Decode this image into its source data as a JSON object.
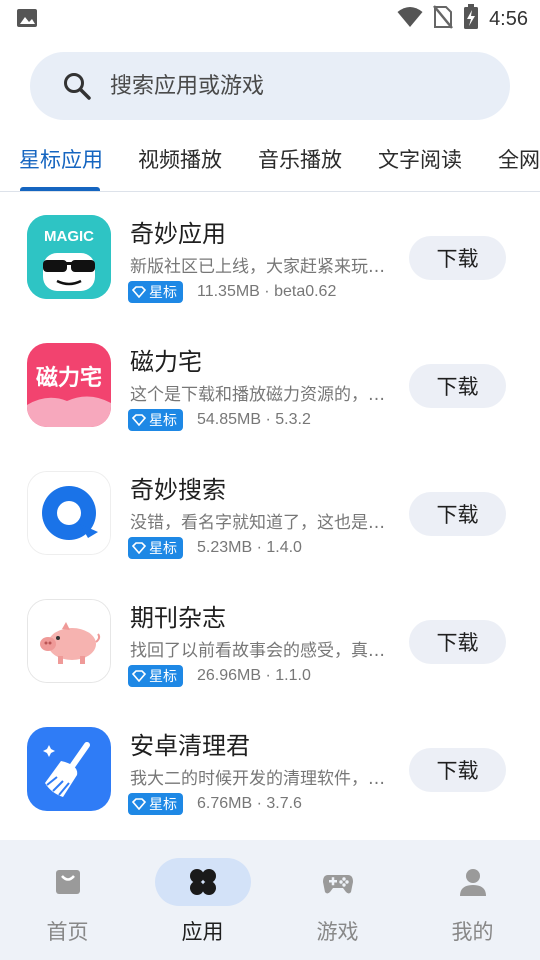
{
  "status": {
    "time": "4:56"
  },
  "search": {
    "placeholder": "搜索应用或游戏"
  },
  "tabs": [
    "星标应用",
    "视频播放",
    "音乐播放",
    "文字阅读",
    "全网"
  ],
  "active_tab": 0,
  "apps": [
    {
      "name": "奇妙应用",
      "desc": "新版社区已上线，大家赶紧来玩…",
      "badge": "星标",
      "meta": "11.35MB · beta0.62",
      "button": "下载",
      "icon_text": "MAGIC"
    },
    {
      "name": "磁力宅",
      "desc": "这个是下载和播放磁力资源的，…",
      "badge": "星标",
      "meta": "54.85MB · 5.3.2",
      "button": "下载",
      "icon_text": "磁力宅"
    },
    {
      "name": "奇妙搜索",
      "desc": "没错，看名字就知道了，这也是…",
      "badge": "星标",
      "meta": "5.23MB · 1.4.0",
      "button": "下载"
    },
    {
      "name": "期刊杂志",
      "desc": "找回了以前看故事会的感受，真…",
      "badge": "星标",
      "meta": "26.96MB · 1.1.0",
      "button": "下载"
    },
    {
      "name": "安卓清理君",
      "desc": "我大二的时候开发的清理软件，…",
      "badge": "星标",
      "meta": "6.76MB · 3.7.6",
      "button": "下载"
    }
  ],
  "nav": [
    {
      "label": "首页",
      "icon": "bag-icon"
    },
    {
      "label": "应用",
      "icon": "apps-icon"
    },
    {
      "label": "游戏",
      "icon": "gamepad-icon"
    },
    {
      "label": "我的",
      "icon": "person-icon"
    }
  ],
  "nav_active": 1,
  "colors": {
    "accent": "#1565c0",
    "badge": "#1e88e5",
    "search_bg": "#e8eef7",
    "nav_bg": "#eef2f8"
  }
}
